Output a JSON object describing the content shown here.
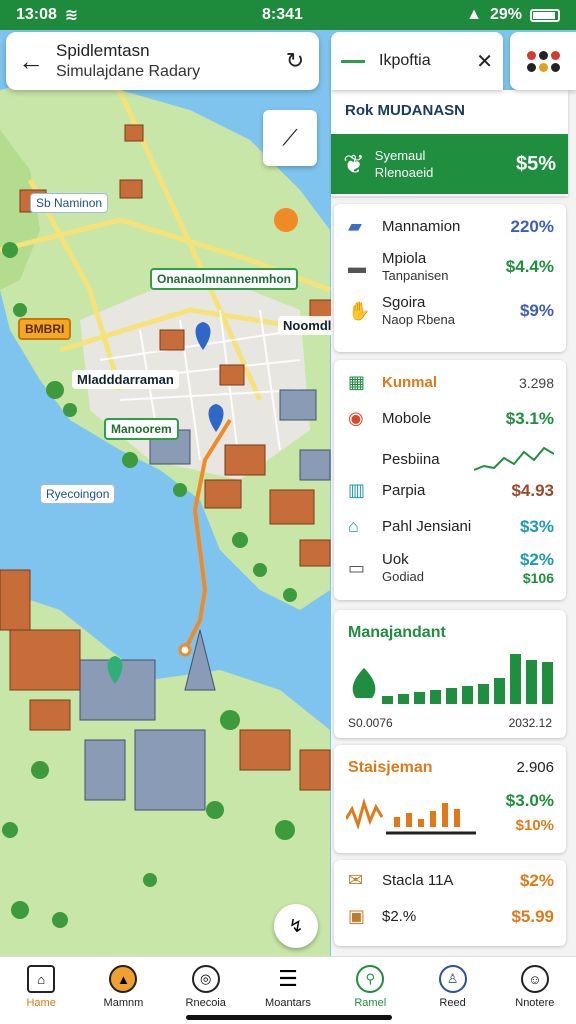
{
  "status": {
    "time": "13:08",
    "center_time": "8:341",
    "battery": "29%"
  },
  "search": {
    "title": "Spidlemtasn",
    "subtitle": "Simulajdane Radary"
  },
  "map_labels": {
    "l1": "Sb Naminon",
    "l2": "Onanaolmnannenmhon",
    "l3": "BMBRI",
    "l4": "Noomdloa",
    "l5": "Mladddarraman",
    "l6": "Manoorem",
    "l7": "Ryecoingon"
  },
  "panel": {
    "header_title": "Ikpoftia",
    "kpi_head": "Rok MUDANASN",
    "highlight": {
      "line1": "Syemaul",
      "line2": "Rlenoaeid",
      "value": "$5%"
    },
    "list1": [
      {
        "label": "Mannamion",
        "value": "220%",
        "color": "#3b5fb8"
      },
      {
        "label": "Mpiola",
        "sub": "Tanpanisen",
        "value": "$4.4%",
        "color": "#1f8f3f"
      },
      {
        "label": "Sgoira",
        "sub": "Naop Rbena",
        "value": "$9%",
        "color": "#3b5fb8"
      }
    ],
    "list2_title": "Kunmal",
    "list2_title_value": "3.298",
    "list2": [
      {
        "label": "Mobole",
        "value": "$3.1%",
        "color": "#1f8f3f"
      },
      {
        "label": "Pesbiina",
        "value": "",
        "color": "#1f8f3f"
      },
      {
        "label": "Parpia",
        "value": "$4.93",
        "color": "#9c4a2a"
      },
      {
        "label": "Pahl Jensiani",
        "value": "$3%",
        "color": "#1e9ab0"
      },
      {
        "label": "Uok",
        "sub": "Godiad",
        "value": "$2%",
        "color": "#1e9ab0",
        "value2": "$106"
      }
    ],
    "chart_card": {
      "title": "Manajandant",
      "left_label": "S0.0076",
      "right_label": "2032.12"
    },
    "stats_card": {
      "title": "Staisjeman",
      "title_value": "2.906",
      "v1": "$3.0%",
      "v2": "$10%"
    },
    "last_card": {
      "r1_label": "Stacla 11A",
      "r1_value": "$2%",
      "r2_label": "$2.%",
      "r2_value": "$5.99"
    }
  },
  "nav": [
    {
      "label": "Hame",
      "icon": "home-icon",
      "active": true
    },
    {
      "label": "Mamnm",
      "icon": "compass-icon"
    },
    {
      "label": "Rnecoia",
      "icon": "camera-icon"
    },
    {
      "label": "Moantars",
      "icon": "menu-icon"
    },
    {
      "label": "Ramel",
      "icon": "search-icon"
    },
    {
      "label": "Reed",
      "icon": "walk-icon"
    },
    {
      "label": "Nnotere",
      "icon": "profile-icon"
    }
  ],
  "colors": {
    "green": "#1f8f3f",
    "orange": "#e07a18",
    "blue": "#3b5fb8",
    "water": "#7fc4ef",
    "land": "#c7e6a8"
  }
}
